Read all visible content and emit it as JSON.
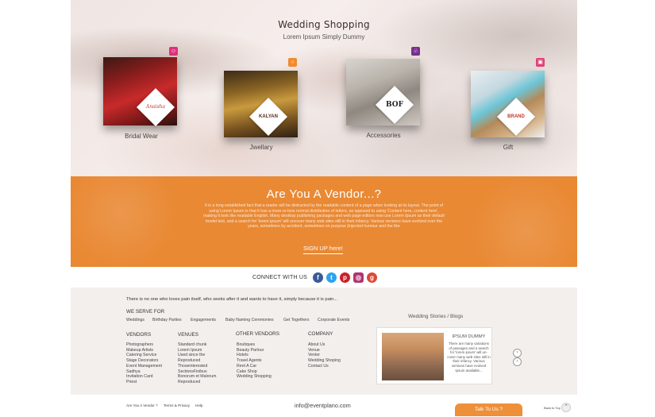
{
  "hero": {
    "title": "Wedding Shopping",
    "subtitle": "Lorem Ipsum Simply Dummy",
    "categories": [
      {
        "label": "Bridal Wear",
        "logo": "Anaisha",
        "badge_icon": "user-icon",
        "badge_color": "#e3307d"
      },
      {
        "label": "Jwellary",
        "logo": "KALYAN",
        "badge_icon": "ring-icon",
        "badge_color": "#f28a2c"
      },
      {
        "label": "Accessories",
        "logo": "BOF",
        "badge_icon": "shoe-icon",
        "badge_color": "#7b2f8e"
      },
      {
        "label": "Gift",
        "logo": "BRAND",
        "badge_icon": "gift-icon",
        "badge_color": "#e1407a"
      }
    ]
  },
  "vendor": {
    "title": "Are You A Vendor...?",
    "text": "It is a long established fact that a reader will be distracted by the readable content of a page when looking at its layout. The point of using Lorem Ipsum is that it has a more-or-less normal distribution of letters, as opposed to using 'Content here, content here', making it look like readable English. Many desktop publishing packages and web page editors now use Lorem Ipsum as their default model text, and a search for 'lorem ipsum' will uncover many web sites still in their infancy. Various versions have evolved over the years, sometimes by accident, sometimes on purpose (injected humour and the like",
    "signup": "SIGN UP here!",
    "color": "#e98934"
  },
  "connect": {
    "label": "CONNECT WITH US",
    "social": [
      {
        "name": "facebook-icon",
        "glyph": "f",
        "color": "#3b5998"
      },
      {
        "name": "twitter-icon",
        "glyph": "t",
        "color": "#2aa3ef"
      },
      {
        "name": "pinterest-icon",
        "glyph": "p",
        "color": "#cb2027"
      },
      {
        "name": "instagram-icon",
        "glyph": "◎",
        "color": "#b1346f"
      },
      {
        "name": "googleplus-icon",
        "glyph": "g",
        "color": "#dc4a38"
      }
    ]
  },
  "footer": {
    "tagline": "There is no one who loves pain itself, who seeks after it and wants to have it, simply because it is pain...",
    "we_serve_title": "WE SERVE FOR",
    "we_serve": [
      "Weddings",
      "Birthday Parties",
      "Engagements",
      "Baby Naming Ceremonies",
      "Get Togethers",
      "Corporate Events"
    ],
    "columns": [
      {
        "title": "VENDORS",
        "items": [
          "Photographers",
          "Makeup Artists",
          "Catering Service",
          "Stage Decorators",
          "Event Management",
          "Sadhya",
          "Invitation Card",
          "Priest"
        ]
      },
      {
        "title": "VENUES",
        "items": [
          "Standard chunk",
          "Lorem Ipsum",
          "Used since the",
          "Reproduced",
          "Thoseinterested",
          "SectionsFinibus",
          "Bonorum et Malorum",
          "Reproduced"
        ]
      },
      {
        "title": "OTHER VENDORS",
        "items": [
          "Boutiques",
          "Beauty Parlour",
          "Hotels",
          "Travel Agents",
          "Rent A Car",
          "Cake Shop",
          "Wedding Shopping"
        ]
      },
      {
        "title": "COMPANY",
        "items": [
          "About Us",
          "Venue",
          "Ventor",
          "Wedding  Shoping",
          "Contact Us"
        ]
      }
    ],
    "blog": {
      "title": "Wedding Stories / Blogs",
      "card_title": "IPSUM DUMMY",
      "card_text": "There are many variations of passages  and a search for 'lorem ipsum' will un-cover many web sites still in their infancy. Various versions have evolved Ipsum available..."
    }
  },
  "bottom": {
    "links": [
      "Are You A Vendor ?",
      "Terms & Privacy",
      "Help"
    ],
    "email": "info@eventplano.com",
    "talk": "Talk To Us ?",
    "back_to_top": "Back to Top"
  }
}
